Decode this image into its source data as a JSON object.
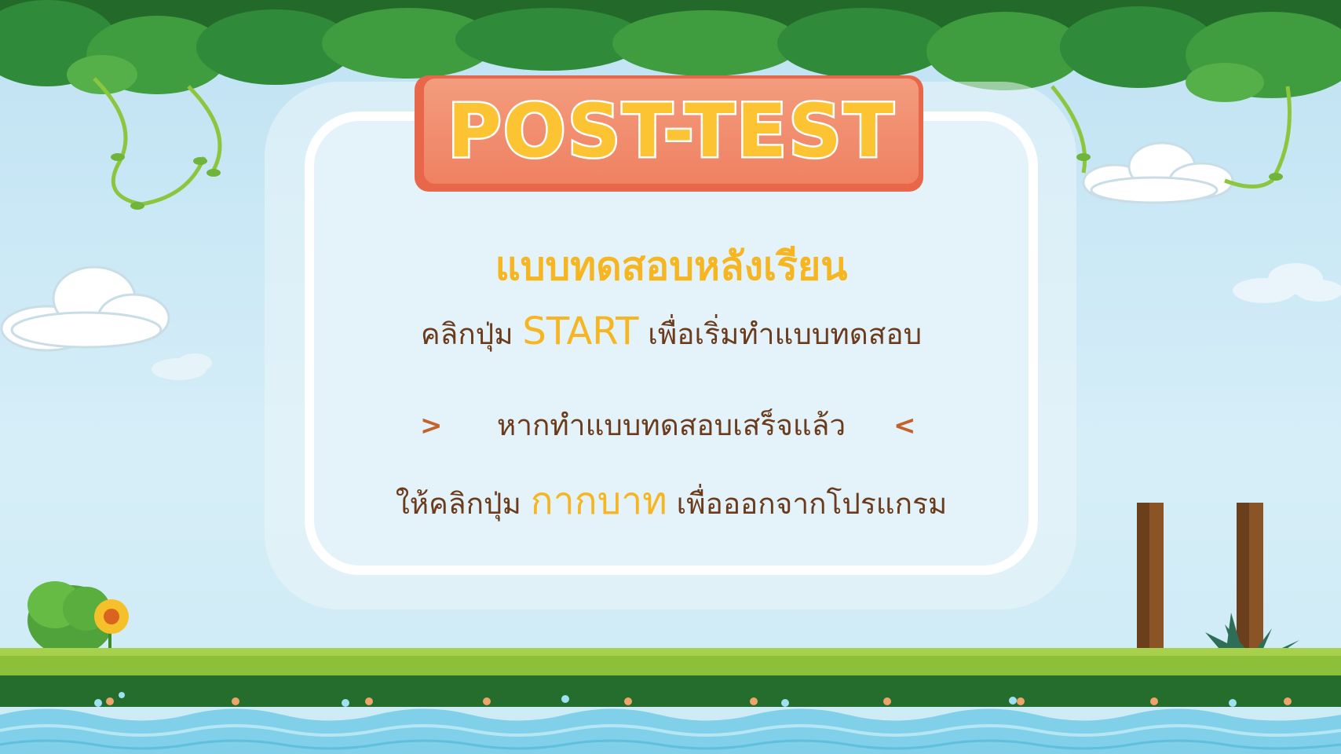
{
  "title_banner": {
    "label": "POST-TEST"
  },
  "content": {
    "heading": "แบบทดสอบหลังเรียน",
    "line1": {
      "before": "คลิกปุ่ม",
      "highlight": "START",
      "after": "เพื่อเริ่มทำแบบทดสอบ"
    },
    "line2": {
      "text": "หากทำแบบทดสอบเสร็จแล้ว",
      "left_marker": ">",
      "right_marker": "<"
    },
    "line3": {
      "before": "ให้คลิกปุ่ม",
      "highlight": "กากบาท",
      "after": "เพื่อออกจากโปรแกรม"
    }
  },
  "colors": {
    "sky": "#cfe9f6",
    "foliage": "#2f8a3a",
    "banner": "#ef8162",
    "banner_text": "#fcc333",
    "heading": "#f5b621",
    "body_text": "#6b3b1d",
    "water": "#7fd0e8",
    "grass": "#8cbf3a"
  },
  "icons": [
    "cloud-icon",
    "sunflower-icon",
    "bush-icon",
    "vine-icon",
    "wooden-post-icon",
    "water-splash-icon"
  ]
}
